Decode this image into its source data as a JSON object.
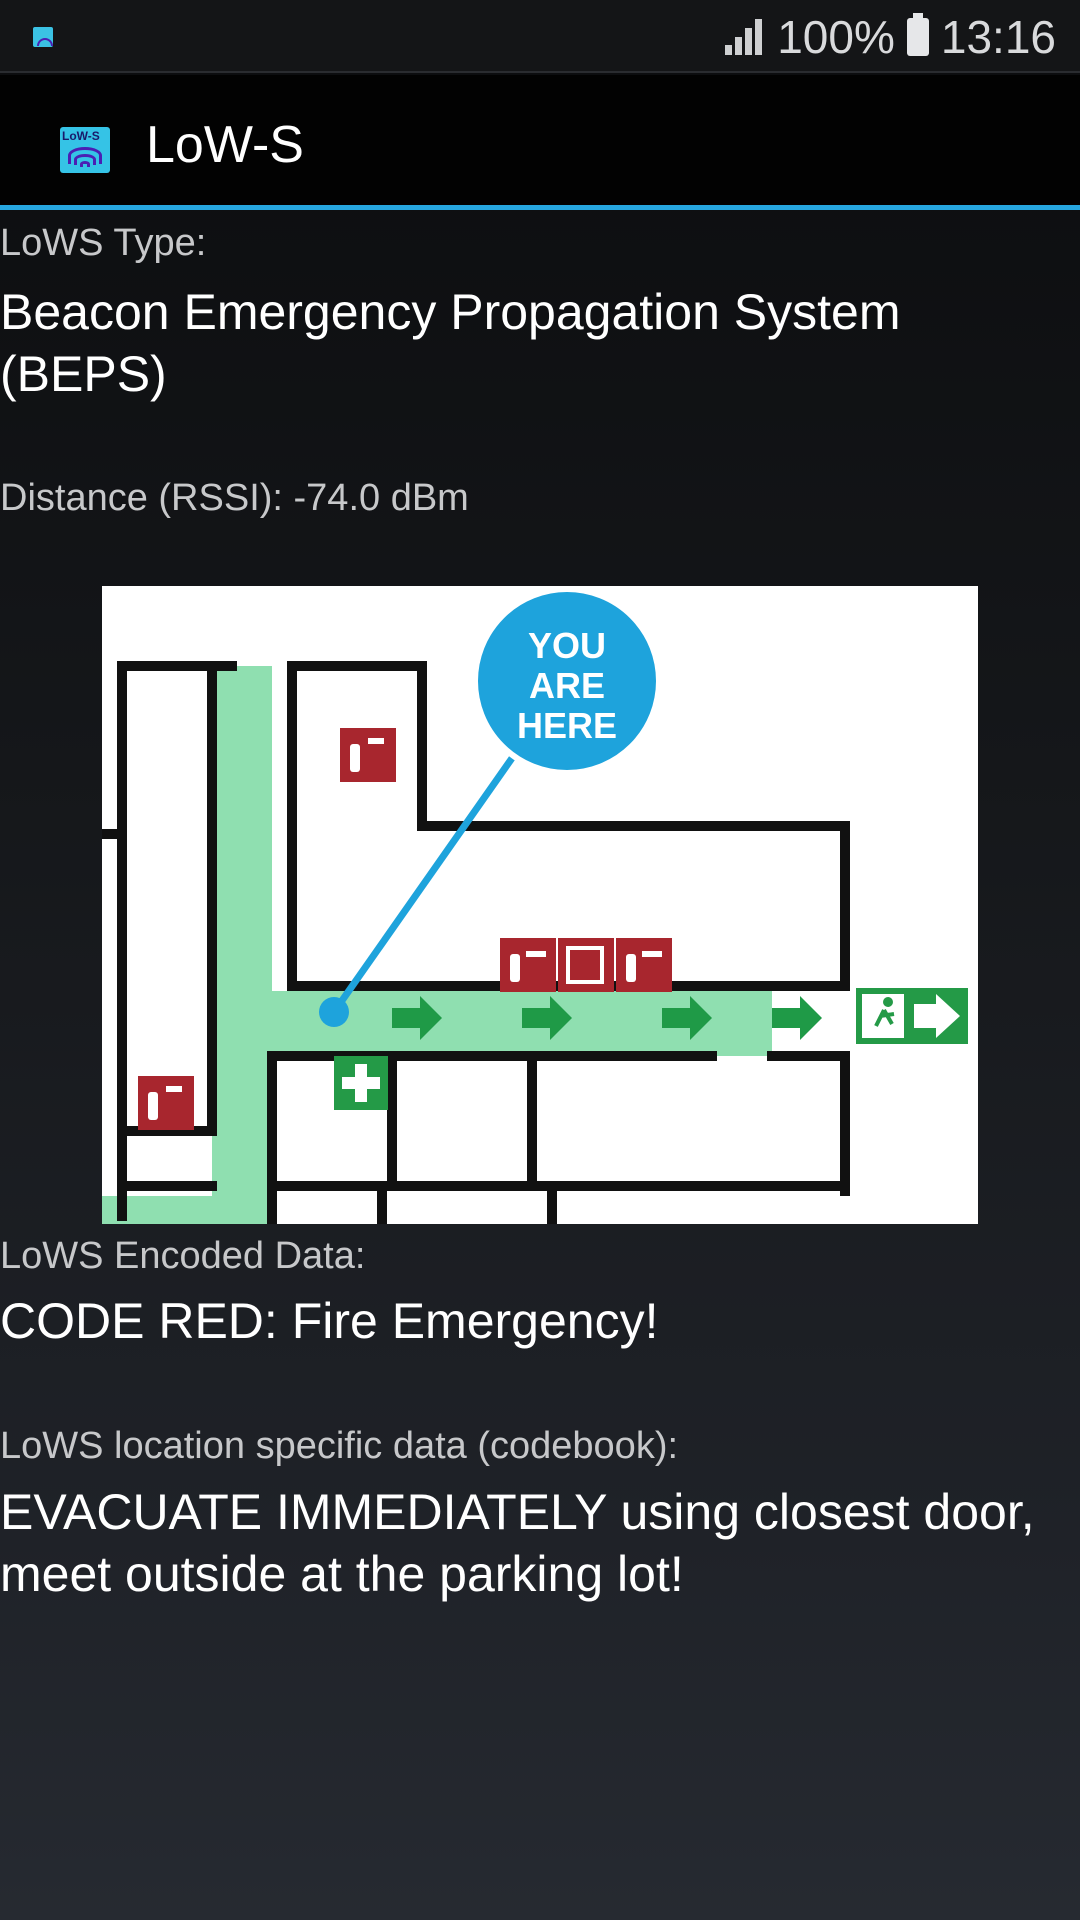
{
  "status_bar": {
    "battery": "100%",
    "time": "13:16"
  },
  "app_bar": {
    "title": "LoW-S",
    "logo_text": "LoW-S"
  },
  "details": {
    "type_label": "LoWS Type:",
    "type_value_line1": "Beacon Emergency Propagation System",
    "type_value_line2": "(BEPS)",
    "distance_text": "Distance (RSSI): -74.0 dBm",
    "encoded_label": "LoWS Encoded Data:",
    "encoded_value": "CODE RED: Fire Emergency!",
    "codebook_label": "LoWS location specific data (codebook):",
    "codebook_line1": "EVACUATE IMMEDIATELY using closest door,",
    "codebook_line2": "meet outside at the parking lot!"
  },
  "map": {
    "marker_line1": "YOU",
    "marker_line2": "ARE",
    "marker_line3": "HERE"
  },
  "colors": {
    "accent": "#27a7e0",
    "corridor": "#8fdfb0",
    "sign_red": "#a8262e",
    "sign_green": "#249a47",
    "marker_blue": "#1ea3dc"
  }
}
